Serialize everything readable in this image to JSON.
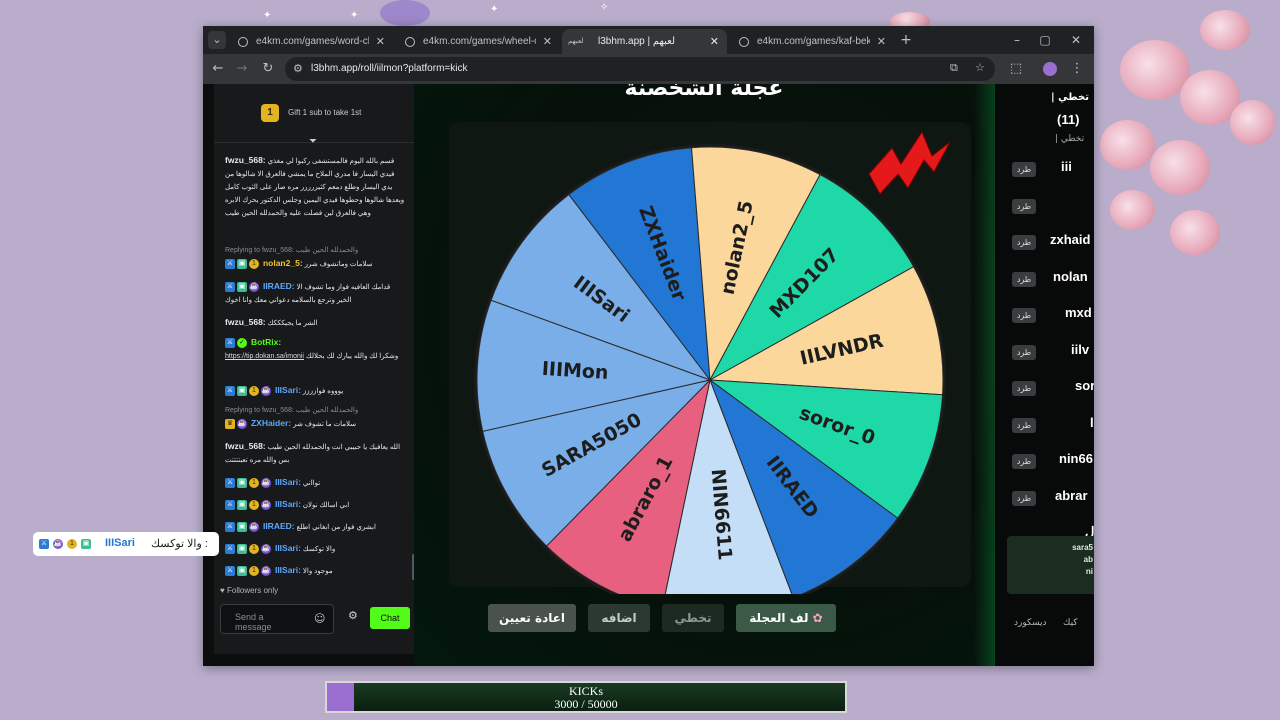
{
  "browser": {
    "tabs": [
      {
        "title": "e4km.com/games/word-challe",
        "active": false
      },
      {
        "title": "e4km.com/games/wheel-of-fat",
        "active": false
      },
      {
        "title": "l3bhm.app | لعبهم",
        "active": true,
        "badge": "لعبهم"
      },
      {
        "title": "e4km.com/games/kaf-bekaf",
        "active": false
      }
    ],
    "url": "l3bhm.app/roll/iilmon?platform=kick"
  },
  "chat": {
    "pinned_text": "Gift 1 sub to take 1st",
    "pinned_rank": "1",
    "messages": [
      {
        "user": "fwzu_568",
        "text": "قسم بالله اليوم فالمستشفى ركبوا لي مغذي فيدي اليسار فا مدري الملاح ما يمشي فالعرق الا شالوها من يدي اليسار وطلع دمعم كثيررررر مره صار على الثوب كامل ويعدها شالوها وحطوها فيدي اليمين وجلس الدكتور يحرك الابره وهي فالعرق لين فصلت عليه والحمدلله الحين طيب",
        "color": "#ffffff"
      },
      {
        "reply": "Replying to fwzu_568: والحمدلله الحين طيب",
        "user": "nolan2_5",
        "text": "سلامات وماتشوف شرر",
        "color": "#f1c232"
      },
      {
        "user": "IIRAED",
        "text": "قدامك العافيه فواز وما تشوف الا الخير وترجع بالسلامه دعواتي معك وانا اخوك",
        "color": "#5aa8ff"
      },
      {
        "user": "fwzu_568",
        "text": "الشر ما يجيكككك",
        "color": "#ffffff"
      },
      {
        "user": "BotRix",
        "link": "https://tip.dokan.sa/imonii",
        "text": "وشكرا لك والله يبارك لك بحلالك",
        "color": "#53fc18"
      },
      {
        "user": "IIISari",
        "text": "يوووه فوازززز",
        "color": "#5aa8ff"
      },
      {
        "reply": "Replying to fwzu_568: والحمدلله الحين طيب",
        "user": "ZXHaider",
        "text": "سلامات ما تشوف شر",
        "color": "#5aa8ff"
      },
      {
        "user": "fwzu_568",
        "text": "الله يعافيك يا حبيبي انت والحمدلله الحين طيب بس والله مره تعبتتتتت",
        "color": "#ffffff"
      },
      {
        "user": "IIISari",
        "text": "توااني",
        "color": "#5aa8ff"
      },
      {
        "user": "IIISari",
        "text": "ابي اسالك نولان",
        "color": "#5aa8ff"
      },
      {
        "user": "IIRAED",
        "text": "ابشري فواز من ابغاني اطلع",
        "color": "#5aa8ff"
      },
      {
        "user": "IIISari",
        "text": "والا توكسك",
        "color": "#5aa8ff"
      },
      {
        "user": "IIISari",
        "text": "موجود والا",
        "color": "#5aa8ff"
      }
    ],
    "followers_only": "Followers only",
    "send_placeholder": "Send a message",
    "chat_button": "Chat"
  },
  "wheel": {
    "title": "عجلة الشخصنة",
    "segments": [
      {
        "name": "IIISari",
        "color": "#79aee8"
      },
      {
        "name": "ZXHaider",
        "color": "#2276d4"
      },
      {
        "name": "nolan2_5",
        "color": "#fbd79b"
      },
      {
        "name": "MXD107",
        "color": "#1ed8a8"
      },
      {
        "name": "IILVNDR",
        "color": "#fbd79b"
      },
      {
        "name": "soror_0",
        "color": "#1ed8a8"
      },
      {
        "name": "IIRAED",
        "color": "#2276d4"
      },
      {
        "name": "NIN6611",
        "color": "#c4def8"
      },
      {
        "name": "abraro_1",
        "color": "#e8607f"
      },
      {
        "name": "SARA5050",
        "color": "#79aee8"
      },
      {
        "name": "IIIMon",
        "color": "#79aee8"
      }
    ],
    "buttons": {
      "spin": "لف العجلة",
      "skip": "تخطي",
      "add": "اضافه",
      "reset": "اعادة تعيين"
    },
    "pointer_color": "#e51919"
  },
  "right_panel": {
    "title": "| تخطي",
    "count": "(11)",
    "subtitle": "| تخطي",
    "kick_label": "طرد",
    "names": [
      "iii",
      "",
      "zxhaid",
      "nolan",
      "mxd",
      "iilv",
      "sor",
      "l",
      "nin66",
      "abrar",
      "ل"
    ],
    "card_lines": [
      "sara5",
      "ab",
      "ni"
    ],
    "footer": [
      "ديسكورد",
      "كيك"
    ]
  },
  "overlay": {
    "message_text": "والا توكسك :",
    "message_user": "IIISari",
    "kicks_label": "KICKs",
    "kicks_value": "3000  /  50000",
    "kicks_progress": 0.06
  }
}
